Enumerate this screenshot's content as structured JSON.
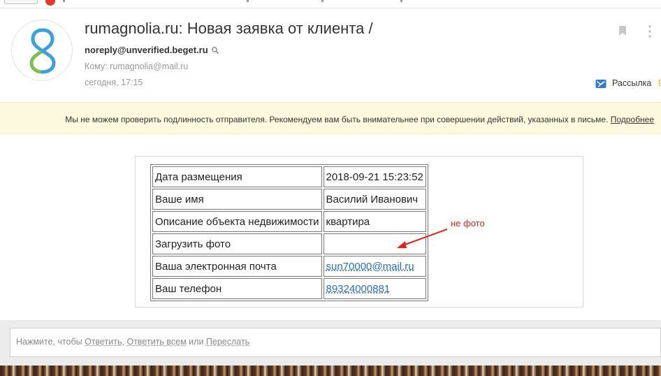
{
  "email": {
    "subject": "rumagnolia.ru: Новая заявка от клиента /",
    "from": "noreply@unverified.beget.ru",
    "to": "Кому: rumagnolia@mail.ru",
    "date": "сегодня, 17:15",
    "mailing_label": "Рассылка",
    "mailing_tail": "9"
  },
  "warning": {
    "text": "Мы не можем проверить подлинность отправителя. Рекомендуем вам быть внимательнее при совершении действий, указанных в письме.",
    "more": "Подробнее"
  },
  "table": {
    "rows": [
      {
        "key": "Дата размещения",
        "value": "2018-09-21 15:23:52"
      },
      {
        "key": "Ваше имя",
        "value": "Василий Иванович"
      },
      {
        "key": "Описание объекта недвижимости",
        "value": "квартира"
      },
      {
        "key": "Загрузить фото",
        "value": ""
      },
      {
        "key": "Ваша электронная почта",
        "value": "sun70000@mail.ru"
      },
      {
        "key": "Ваш телефон",
        "value": "89324000881"
      }
    ]
  },
  "annotation": {
    "text": "не фото",
    "color": "#e2231a"
  },
  "reply": {
    "prefix": "Нажмите, чтобы",
    "reply_label": "Ответить",
    "sep1": ",",
    "reply_all_label": "Ответить всем",
    "or": "или",
    "forward_label": "Переслать"
  },
  "icons": {
    "avatar": "sender-logo-icon",
    "search": "search-icon",
    "bookmark": "bookmark-icon",
    "more": "more-vertical-icon",
    "mailing": "mailing-icon"
  }
}
